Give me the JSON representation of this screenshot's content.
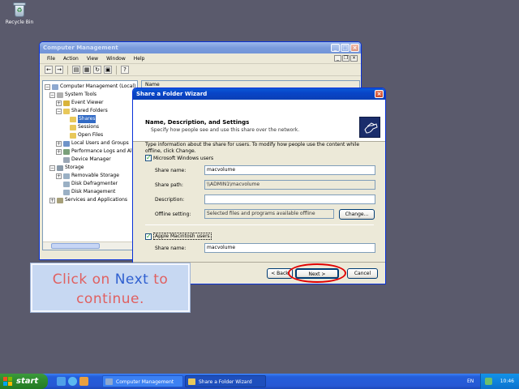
{
  "desktop": {
    "recycle_bin_label": "Recycle Bin"
  },
  "computer_management": {
    "title": "Computer Management",
    "menu": [
      "File",
      "Action",
      "View",
      "Window",
      "Help"
    ],
    "tree": [
      {
        "label": "Computer Management (Local)",
        "icon": "computer-icon"
      },
      {
        "label": "System Tools",
        "icon": "tools-icon"
      },
      {
        "label": "Event Viewer",
        "icon": "event-viewer-icon"
      },
      {
        "label": "Shared Folders",
        "icon": "folder-icon"
      },
      {
        "label": "Shares",
        "icon": "folder-icon"
      },
      {
        "label": "Sessions",
        "icon": "folder-icon"
      },
      {
        "label": "Open Files",
        "icon": "folder-icon"
      },
      {
        "label": "Local Users and Groups",
        "icon": "users-icon"
      },
      {
        "label": "Performance Logs and Al",
        "icon": "perf-icon"
      },
      {
        "label": "Device Manager",
        "icon": "device-icon"
      },
      {
        "label": "Storage",
        "icon": "storage-icon"
      },
      {
        "label": "Removable Storage",
        "icon": "disk-icon"
      },
      {
        "label": "Disk Defragmenter",
        "icon": "disk-icon"
      },
      {
        "label": "Disk Management",
        "icon": "disk-icon"
      },
      {
        "label": "Services and Applications",
        "icon": "services-icon"
      }
    ],
    "right_header": "Name"
  },
  "wizard": {
    "title": "Share a Folder Wizard",
    "header_title": "Name, Description, and Settings",
    "header_subtitle": "Specify how people see and use this share over the network.",
    "intro": "Type information about the share for users. To modify how people use the content while offline, click Change.",
    "windows_users_label": "Microsoft Windows users",
    "share_name_label": "Share name:",
    "share_name_value": "macvolume",
    "share_path_label": "Share path:",
    "share_path_value": "\\\\ADMIN1\\macvolume",
    "description_label": "Description:",
    "description_value": "",
    "offline_label": "Offline setting:",
    "offline_value": "Selected files and programs available offline",
    "change_button": "Change...",
    "mac_users_label": "Apple Macintosh users",
    "mac_share_name_label": "Share name:",
    "mac_share_name_value": "macvolume",
    "back_button": "< Back",
    "next_button": "Next >",
    "cancel_button": "Cancel"
  },
  "callout": {
    "prefix": "Click on ",
    "highlight": "Next",
    "suffix": " to continue."
  },
  "taskbar": {
    "start_label": "start",
    "tasks": [
      "Computer Management",
      "Share a Folder Wizard"
    ],
    "language": "EN",
    "clock": "10:46"
  },
  "colors": {
    "desktop": "#5a5a6c",
    "title_active": "#0a5ad8",
    "callout_bg": "#c7d8f2",
    "highlight_ring": "#e00000"
  }
}
